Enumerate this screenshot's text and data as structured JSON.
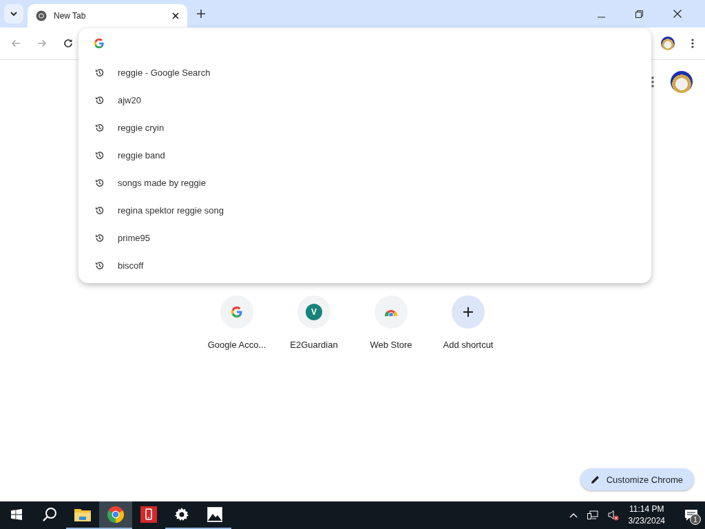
{
  "tabs": [
    {
      "title": "New Tab",
      "selected": true
    }
  ],
  "suggestions": [
    {
      "text": "reggie - Google Search"
    },
    {
      "text": "ajw20"
    },
    {
      "text": "reggie cryin"
    },
    {
      "text": "reggie band"
    },
    {
      "text": "songs made by reggie"
    },
    {
      "text": "regina spektor reggie song"
    },
    {
      "text": "prime95"
    },
    {
      "text": "biscoff"
    }
  ],
  "shortcuts": [
    {
      "label": "Google Acco...",
      "kind": "google"
    },
    {
      "label": "E2Guardian",
      "kind": "letter",
      "letter": "V"
    },
    {
      "label": "Web Store",
      "kind": "store"
    },
    {
      "label": "Add shortcut",
      "kind": "add"
    }
  ],
  "customize_button": "Customize Chrome",
  "taskbar": {
    "apps": [
      {
        "kind": "start",
        "running": false,
        "selected": false
      },
      {
        "kind": "search",
        "running": false,
        "selected": false
      },
      {
        "kind": "files",
        "running": true,
        "selected": false
      },
      {
        "kind": "chrome",
        "running": true,
        "selected": true
      },
      {
        "kind": "phone",
        "running": false,
        "selected": false
      },
      {
        "kind": "settings",
        "running": true,
        "selected": false
      },
      {
        "kind": "photos",
        "running": true,
        "selected": false
      }
    ],
    "time": "11:14 PM",
    "date": "3/23/2024",
    "notifications": "1"
  }
}
